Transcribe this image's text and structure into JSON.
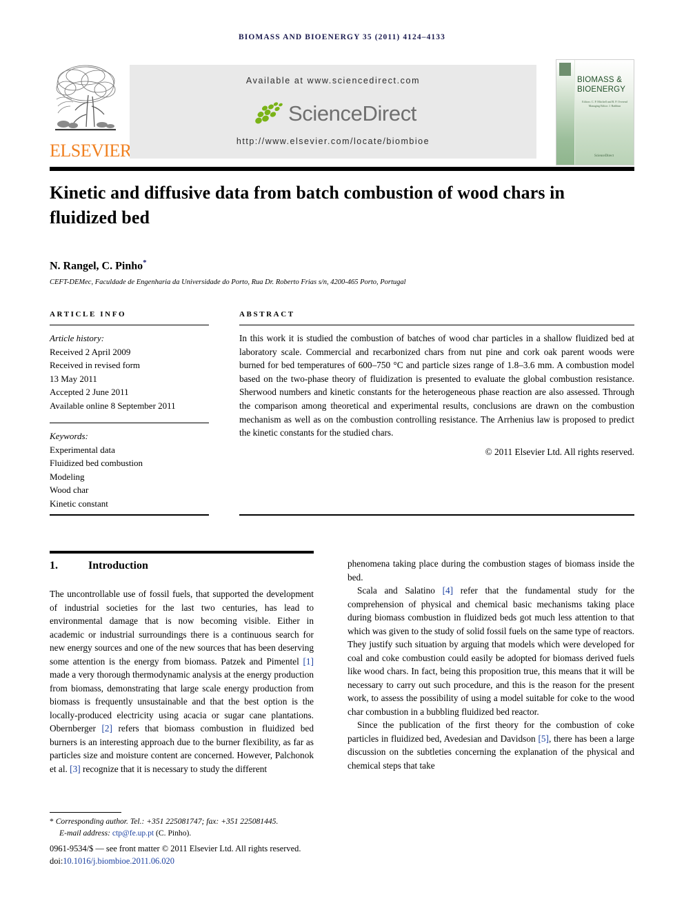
{
  "running_head": "Biomass and bioenergy 35 (2011) 4124–4133",
  "masthead": {
    "elsevier_wordmark": "ELSEVIER",
    "available_at": "Available at www.sciencedirect.com",
    "sciencedirect_wordmark": "ScienceDirect",
    "journal_url": "http://www.elsevier.com/locate/biombioe",
    "cover": {
      "title": "BIOMASS & BIOENERGY",
      "subtitle": "Editors: C. P. Mitchell and R. P. Overend\nManaging Editor: J. Rathbun",
      "footer": "ScienceDirect"
    },
    "colors": {
      "banner_background": "#e9e9e9",
      "elsevier_orange": "#f08020",
      "sciencedirect_green": "#7ab317",
      "sciencedirect_gray": "#6f6f6f",
      "running_head_navy": "#1a1a4e"
    }
  },
  "article": {
    "title": "Kinetic and diffusive data from batch combustion of wood chars in fluidized bed",
    "authors": "N. Rangel, C. Pinho",
    "author_footnote_marker": "*",
    "affiliation": "CEFT-DEMec, Faculdade de Engenharia da Universidade do Porto, Rua Dr. Roberto Frias s/n, 4200-465 Porto, Portugal"
  },
  "article_info": {
    "label": "ARTICLE INFO",
    "history_label": "Article history:",
    "history": [
      "Received 2 April 2009",
      "Received in revised form",
      "13 May 2011",
      "Accepted 2 June 2011",
      "Available online 8 September 2011"
    ],
    "keywords_label": "Keywords:",
    "keywords": [
      "Experimental data",
      "Fluidized bed combustion",
      "Modeling",
      "Wood char",
      "Kinetic constant"
    ]
  },
  "abstract": {
    "label": "ABSTRACT",
    "text": "In this work it is studied the combustion of batches of wood char particles in a shallow fluidized bed at laboratory scale. Commercial and recarbonized chars from nut pine and cork oak parent woods were burned for bed temperatures of 600–750 °C and particle sizes range of 1.8–3.6 mm. A combustion model based on the two-phase theory of fluidization is presented to evaluate the global combustion resistance. Sherwood numbers and kinetic constants for the heterogeneous phase reaction are also assessed. Through the comparison among theoretical and experimental results, conclusions are drawn on the combustion mechanism as well as on the combustion controlling resistance. The Arrhenius law is proposed to predict the kinetic constants for the studied chars.",
    "copyright": "© 2011 Elsevier Ltd. All rights reserved."
  },
  "introduction": {
    "number": "1.",
    "heading": "Introduction",
    "left_paragraphs": [
      "The uncontrollable use of fossil fuels, that supported the development of industrial societies for the last two centuries, has lead to environmental damage that is now becoming visible. Either in academic or industrial surroundings there is a continuous search for new energy sources and one of the new sources that has been deserving some attention is the energy from biomass. Patzek and Pimentel [1] made a very thorough thermodynamic analysis at the energy production from biomass, demonstrating that large scale energy production from biomass is frequently unsustainable and that the best option is the locally-produced electricity using acacia or sugar cane plantations. Obernberger [2] refers that biomass combustion in fluidized bed burners is an interesting approach due to the burner flexibility, as far as particles size and moisture content are concerned. However, Palchonok et al. [3] recognize that it is necessary to study the different"
    ],
    "right_paragraphs": [
      "phenomena taking place during the combustion stages of biomass inside the bed.",
      "Scala and Salatino [4] refer that the fundamental study for the comprehension of physical and chemical basic mechanisms taking place during biomass combustion in fluidized beds got much less attention to that which was given to the study of solid fossil fuels on the same type of reactors. They justify such situation by arguing that models which were developed for coal and coke combustion could easily be adopted for biomass derived fuels like wood chars. In fact, being this proposition true, this means that it will be necessary to carry out such procedure, and this is the reason for the present work, to assess the possibility of using a model suitable for coke to the wood char combustion in a bubbling fluidized bed reactor.",
      "Since the publication of the first theory for the combustion of coke particles in fluidized bed, Avedesian and Davidson [5], there has been a large discussion on the subtleties concerning the explanation of the physical and chemical steps that take"
    ]
  },
  "footer": {
    "corresponding_marker": "*",
    "corresponding_text": "Corresponding author. Tel.: +351 225081747; fax: +351 225081445.",
    "email_label": "E-mail address:",
    "email": "ctp@fe.up.pt",
    "email_owner": "(C. Pinho).",
    "front_matter": "0961-9534/$ — see front matter © 2011 Elsevier Ltd. All rights reserved.",
    "doi_label": "doi:",
    "doi": "10.1016/j.biombioe.2011.06.020"
  }
}
